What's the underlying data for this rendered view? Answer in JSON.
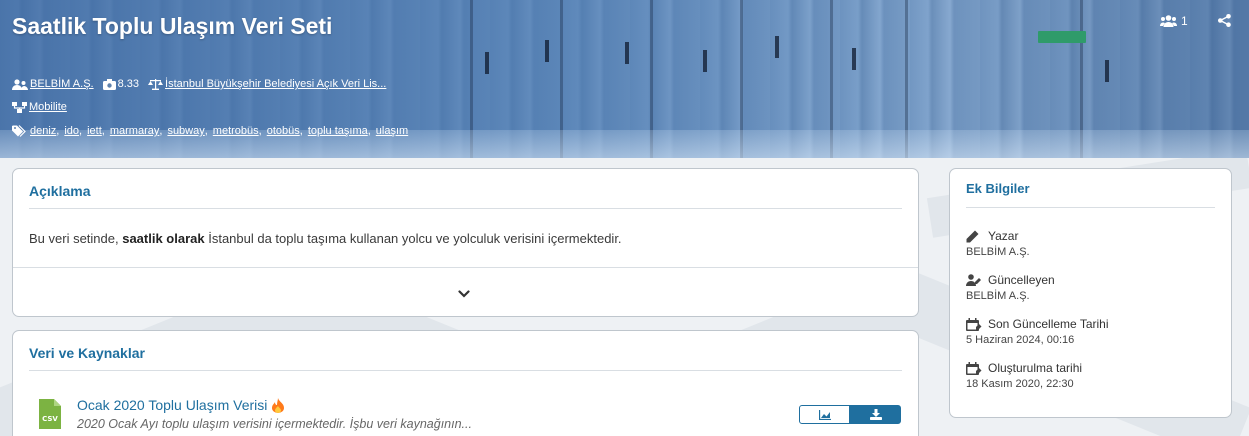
{
  "dataset": {
    "title": "Saatlik Toplu Ulaşım Veri Seti",
    "organization": "BELBİM A.Ş.",
    "score": "8.33",
    "license": "İstanbul Büyükşehir Belediyesi Açık Veri Lis...",
    "category": "Mobilite",
    "tags": [
      "deniz",
      "ido",
      "iett",
      "marmaray",
      "subway",
      "metrobüs",
      "otobüs",
      "toplu taşıma",
      "ulaşım"
    ],
    "followers": "1"
  },
  "description": {
    "title": "Açıklama",
    "text_before": "Bu veri setinde, ",
    "text_bold": "saatlik olarak",
    "text_after": " İstanbul da toplu taşıma kullanan yolcu ve yolculuk verisini içermektedir."
  },
  "resources": {
    "title": "Veri ve Kaynaklar",
    "items": [
      {
        "name": "Ocak 2020 Toplu Ulaşım Verisi",
        "format": "CSV",
        "description": "2020 Ocak Ayı toplu ulaşım verisini içermektedir. İşbu veri kaynağının..."
      }
    ]
  },
  "additional_info": {
    "title": "Ek Bilgiler",
    "author_label": "Yazar",
    "author_value": "BELBİM A.Ş.",
    "updater_label": "Güncelleyen",
    "updater_value": "BELBİM A.Ş.",
    "last_updated_label": "Son Güncelleme Tarihi",
    "last_updated_value": "5 Haziran 2024, 00:16",
    "created_label": "Oluşturulma tarihi",
    "created_value": "18 Kasım 2020, 22:30"
  },
  "colors": {
    "accent": "#1f6f9f",
    "csv_green": "#7cb342",
    "fire": "#ff7a1a"
  },
  "icons": [
    "user-group-icon",
    "camera-icon",
    "scale-icon",
    "sitemap-icon",
    "tags-icon",
    "users-icon",
    "share-icon",
    "chevron-down-icon",
    "csv-file-icon",
    "fire-icon",
    "chart-icon",
    "download-icon",
    "pen-icon",
    "user-edit-icon",
    "calendar-icon"
  ]
}
